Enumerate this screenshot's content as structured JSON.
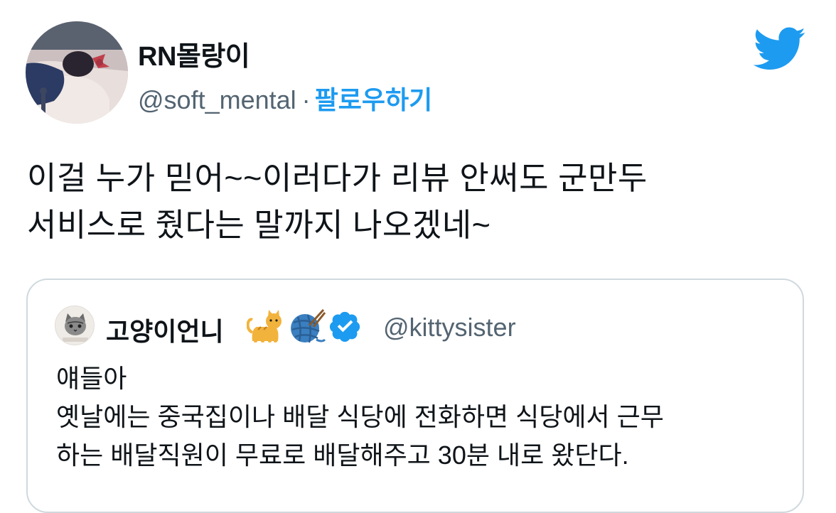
{
  "tweet": {
    "author": {
      "display_name": "RN몰랑이",
      "handle": "@soft_mental",
      "separator": "·",
      "follow_label": "팔로우하기"
    },
    "text": "이걸 누가 믿어~~이러다가 리뷰 안써도 군만두\n서비스로 줬다는 말까지 나오겠네~",
    "logo_icon": "twitter-bird-icon",
    "colors": {
      "accent": "#1d9bf0",
      "text": "#0f1419",
      "secondary_text": "#536471",
      "border": "#cfd9de"
    }
  },
  "quoted_tweet": {
    "author": {
      "display_name": "고양이언니",
      "emojis": [
        "cat-emoji-icon",
        "yarn-ball-emoji-icon"
      ],
      "verified_icon": "verified-badge-icon",
      "handle": "@kittysister"
    },
    "text": "얘들아\n옛날에는 중국집이나 배달 식당에 전화하면 식당에서 근무\n하는 배달직원이 무료로 배달해주고 30분 내로 왔단다."
  }
}
